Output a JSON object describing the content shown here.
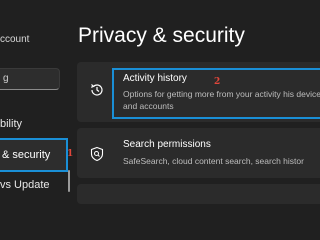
{
  "sidebar": {
    "account_text": "ccount",
    "search_value": "g",
    "items": [
      {
        "label": "bility"
      },
      {
        "label": "& security",
        "selected": true
      },
      {
        "label": "vs Update"
      }
    ]
  },
  "annotations": {
    "marker1": "1",
    "marker2": "2"
  },
  "page": {
    "title": "Privacy & security"
  },
  "cards": [
    {
      "title": "Activity history",
      "description": "Options for getting more from your activity his devices and accounts",
      "icon": "activity-history-icon",
      "highlighted": true
    },
    {
      "title": "Search permissions",
      "description": "SafeSearch, cloud content search, search histor",
      "icon": "search-permissions-icon",
      "highlighted": false
    }
  ],
  "colors": {
    "background": "#202020",
    "card": "#2b2b2b",
    "highlight_border": "#1a8fd6",
    "annotation": "#e0463b"
  }
}
